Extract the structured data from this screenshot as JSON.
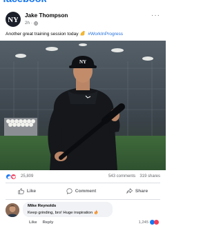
{
  "app": {
    "brand": "facebook"
  },
  "post": {
    "author": "Jake Thompson",
    "time": "2h",
    "text_before": "Another great training session today",
    "hashtag": "#WorkInProgress"
  },
  "stats": {
    "reactions": "25,809",
    "comments": "543 comments",
    "shares": "319 shares"
  },
  "actions": {
    "like": "Like",
    "comment": "Comment",
    "share": "Share"
  },
  "comment": {
    "author": "Mike Reynolds",
    "text": "Keep grinding, bro! Huge inspiration",
    "like": "Like",
    "reply": "Reply",
    "reaction_count": "1,245"
  },
  "colors": {
    "brand": "#1877f2",
    "hashtag": "#216fdb",
    "love": "#f33e58",
    "muted": "#65676b"
  },
  "icons": {
    "avatar": "team-logo-icon",
    "audience": "globe-icon",
    "more": "more-icon",
    "flex": "flexed-biceps-emoji",
    "like": "thumbs-up-icon",
    "comment": "comment-bubble-icon",
    "share": "share-arrow-icon",
    "fire": "fire-emoji"
  }
}
